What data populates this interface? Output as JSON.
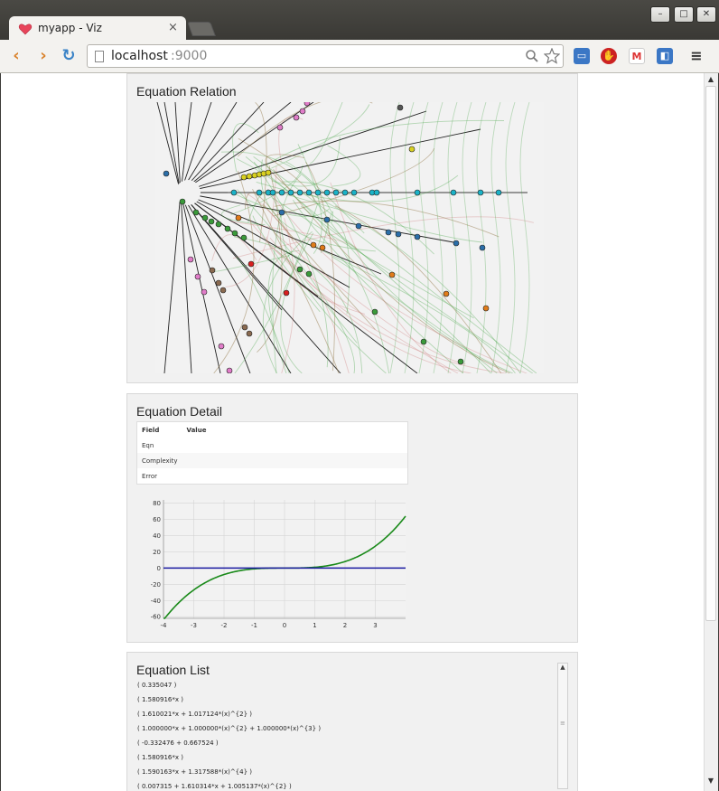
{
  "browser": {
    "tab_title": "myapp - Viz",
    "url_host": "localhost",
    "url_port": ":9000",
    "win_minimize": "–",
    "win_maximize": "□",
    "win_close": "✕",
    "tab_close": "×",
    "back": "‹",
    "forward": "›",
    "reload": "↻"
  },
  "panels": {
    "relation": {
      "title": "Equation Relation"
    },
    "detail": {
      "title": "Equation Detail",
      "table_headers": [
        "Field",
        "Value"
      ],
      "rows": [
        {
          "field": "Eqn",
          "value": ""
        },
        {
          "field": "Complexity",
          "value": ""
        },
        {
          "field": "Error",
          "value": ""
        }
      ]
    },
    "list": {
      "title": "Equation List",
      "items": [
        "( 0.335047 )",
        "( 1.580916*x )",
        "( 1.610021*x + 1.017124*(x)^{2} )",
        "( 1.000000*x + 1.000000*(x)^{2} + 1.000000*(x)^{3} )",
        "( -0.332476 + 0.667524 )",
        "( 1.580916*x )",
        "( 1.590163*x + 1.317588*(x)^{4} )",
        "( 0.007315 + 1.610314*x + 1.005137*(x)^{2} )"
      ]
    }
  },
  "chart_data": {
    "type": "line",
    "x_ticks": [
      -4,
      -3,
      -2,
      -1,
      0,
      1,
      2,
      3
    ],
    "y_ticks": [
      80,
      60,
      40,
      20,
      0,
      -20,
      -40,
      -60
    ],
    "xlim": [
      -4,
      4
    ],
    "ylim": [
      -62,
      84
    ],
    "grid": true,
    "series": [
      {
        "color": "#1a8a1a",
        "expression": "x^3",
        "x_range": [
          -4,
          4
        ]
      },
      {
        "color": "#1a1aa0",
        "expression": "0",
        "x_range": [
          -4,
          4
        ]
      }
    ]
  }
}
